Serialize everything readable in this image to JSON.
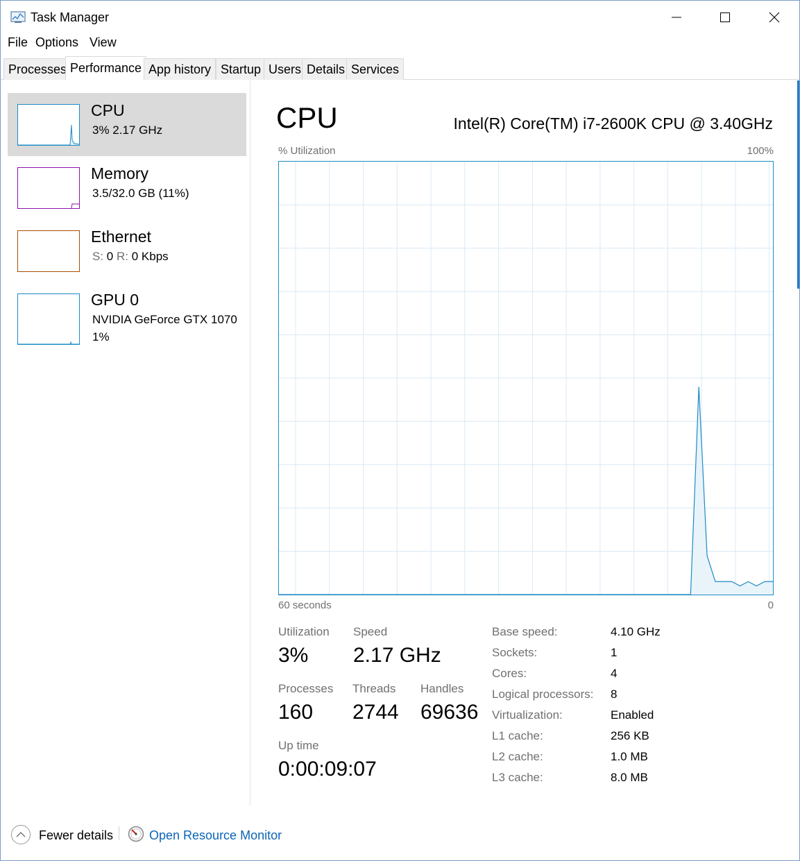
{
  "window": {
    "title": "Task Manager",
    "controls": {
      "minimize": "minimize",
      "maximize": "maximize",
      "close": "close"
    }
  },
  "menu": [
    "File",
    "Options",
    "View"
  ],
  "tabs": [
    "Processes",
    "Performance",
    "App history",
    "Startup",
    "Users",
    "Details",
    "Services"
  ],
  "active_tab": "Performance",
  "sidebar": {
    "cpu": {
      "title": "CPU",
      "line1": "3%  2.17 GHz",
      "color": "#1d8bc5"
    },
    "memory": {
      "title": "Memory",
      "line1": "3.5/32.0 GB (11%)",
      "color": "#8b12ae"
    },
    "ethernet": {
      "title": "Ethernet",
      "s_label": "S:",
      "s_value": "0",
      "r_label": "R:",
      "r_value": "0 Kbps",
      "color": "#a74f01"
    },
    "gpu": {
      "title": "GPU 0",
      "line1": "NVIDIA GeForce GTX 1070",
      "line2": "1%",
      "color": "#1d8bc5"
    }
  },
  "main": {
    "title": "CPU",
    "cpu_name": "Intel(R) Core(TM) i7-2600K CPU @ 3.40GHz",
    "utilization_axis_label": "% Utilization",
    "max_label": "100%",
    "time_label": "60 seconds",
    "min_label": "0",
    "stats": {
      "utilization_label": "Utilization",
      "utilization": "3%",
      "speed_label": "Speed",
      "speed": "2.17 GHz",
      "processes_label": "Processes",
      "processes": "160",
      "threads_label": "Threads",
      "threads": "2744",
      "handles_label": "Handles",
      "handles": "69636",
      "uptime_label": "Up time",
      "uptime": "0:00:09:07"
    },
    "details": [
      {
        "label": "Base speed:",
        "value": "4.10 GHz"
      },
      {
        "label": "Sockets:",
        "value": "1"
      },
      {
        "label": "Cores:",
        "value": "4"
      },
      {
        "label": "Logical processors:",
        "value": "8"
      },
      {
        "label": "Virtualization:",
        "value": "Enabled"
      },
      {
        "label": "L1 cache:",
        "value": "256 KB"
      },
      {
        "label": "L2 cache:",
        "value": "1.0 MB"
      },
      {
        "label": "L3 cache:",
        "value": "8.0 MB"
      }
    ]
  },
  "cpu_history": {
    "seconds_ago": [
      60,
      10,
      9,
      8,
      7,
      6,
      5,
      4,
      3,
      2,
      1,
      0
    ],
    "utilization_pct": [
      0,
      0,
      48,
      9,
      3,
      3,
      3,
      2,
      3,
      2,
      3,
      3
    ]
  },
  "footer": {
    "fewer_details": "Fewer details",
    "open_resource_monitor": "Open Resource Monitor"
  }
}
